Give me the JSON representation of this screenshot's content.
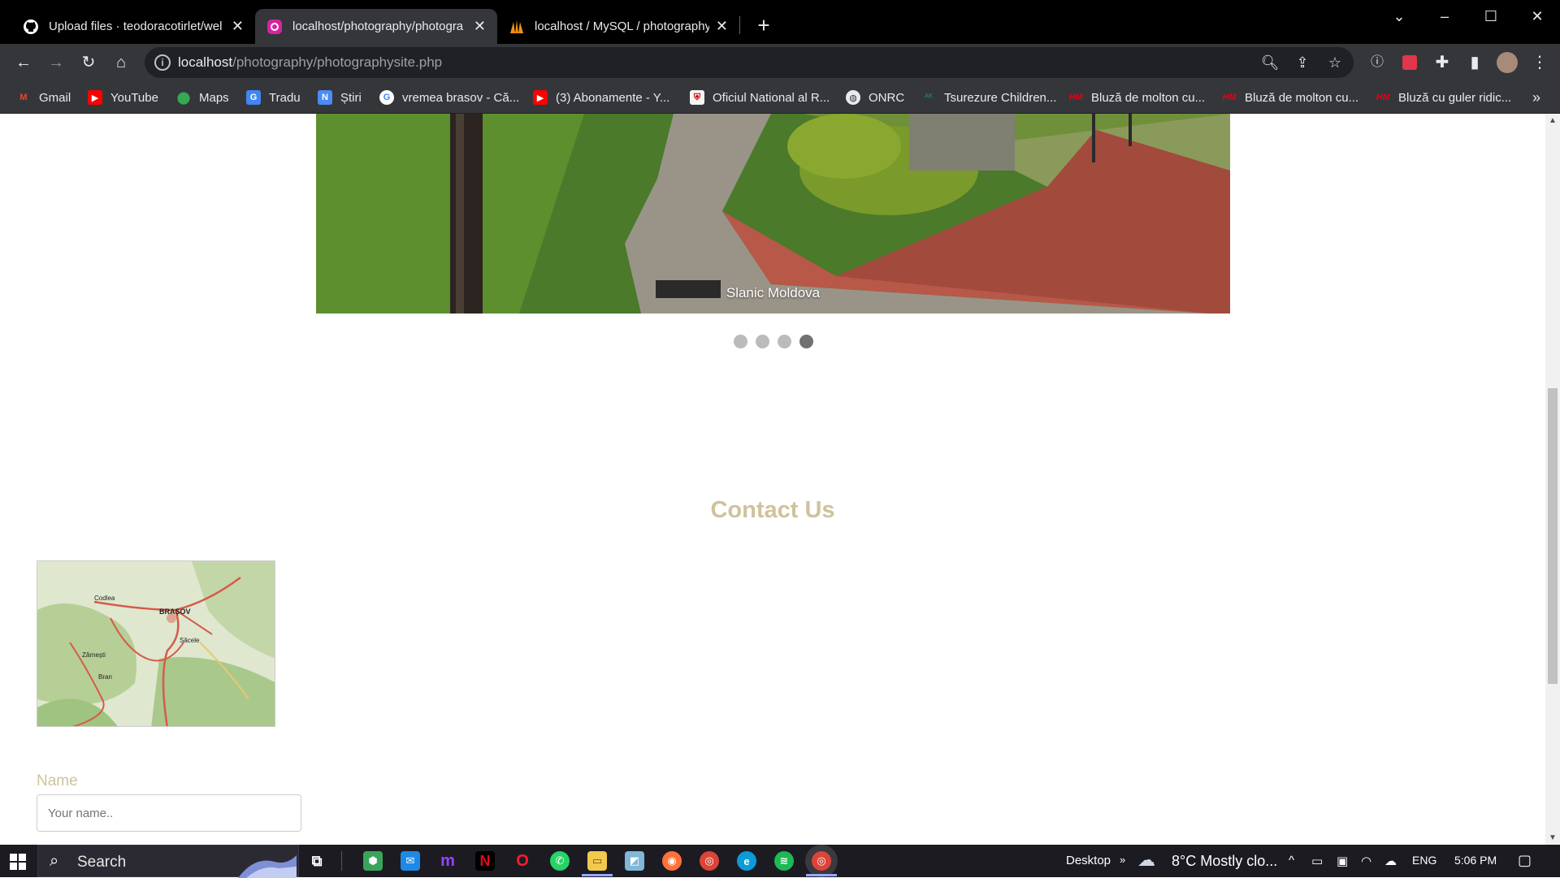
{
  "browser": {
    "tabs": [
      {
        "title": "Upload files · teodoracotirlet/wel",
        "icon": "github-icon",
        "active": false
      },
      {
        "title": "localhost/photography/photogra",
        "icon": "site-favicon-icon",
        "active": true
      },
      {
        "title": "localhost / MySQL / photography",
        "icon": "phpmyadmin-icon",
        "active": false
      }
    ],
    "new_tab": "+",
    "url_host": "localhost",
    "url_path": "/photography/photographysite.php",
    "bookmarks": [
      {
        "label": "Gmail",
        "icon": "gmail-icon",
        "color": "#ea4335"
      },
      {
        "label": "YouTube",
        "icon": "youtube-icon",
        "color": "#ff0000"
      },
      {
        "label": "Maps",
        "icon": "maps-icon",
        "color": "#34a853"
      },
      {
        "label": "Tradu",
        "icon": "translate-icon",
        "color": "#4285f4"
      },
      {
        "label": "Știri",
        "icon": "news-icon",
        "color": "#4c8bf5"
      },
      {
        "label": "vremea brasov - Că...",
        "icon": "google-icon",
        "color": "#ffffff"
      },
      {
        "label": "(3) Abonamente - Y...",
        "icon": "youtube-icon",
        "color": "#ff0000"
      },
      {
        "label": "Oficiul National al R...",
        "icon": "onrc-icon",
        "color": "#f5f5f5"
      },
      {
        "label": "ONRC",
        "icon": "globe-icon",
        "color": "#9aa0a6"
      },
      {
        "label": "Tsurezure Children...",
        "icon": "anime-icon",
        "color": "#1a7f6b"
      },
      {
        "label": "Bluză de molton cu...",
        "icon": "hm-icon",
        "color": "#e50010"
      },
      {
        "label": "Bluză de molton cu...",
        "icon": "hm-icon",
        "color": "#e50010"
      },
      {
        "label": "Bluză cu guler ridic...",
        "icon": "hm-icon",
        "color": "#e50010"
      }
    ]
  },
  "page": {
    "slide_caption": "Slanic Moldova",
    "slide_count": 4,
    "active_slide": 4,
    "contact_title": "Contact Us",
    "map_labels": {
      "city": "BRAȘOV",
      "town1": "Codlea",
      "town2": "Zărnești",
      "town3": "Bran",
      "town4": "Săcele"
    },
    "name_label": "Name",
    "name_placeholder": "Your name.."
  },
  "taskbar": {
    "search": "Search",
    "desktop": "Desktop",
    "weather": "8°C  Mostly clo...",
    "lang": "ENG",
    "time": "5:06 PM"
  },
  "colors": {
    "accent": "#cfc29c",
    "tab_strip": "#000000",
    "toolbar": "#35363a"
  }
}
